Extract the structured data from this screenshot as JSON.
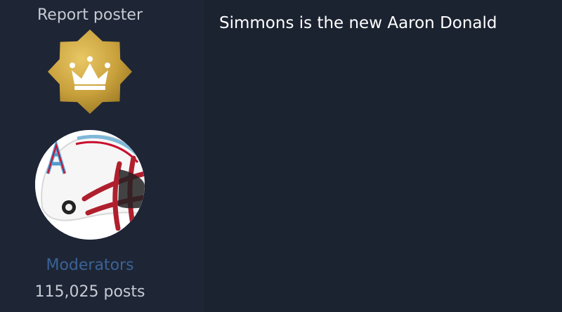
{
  "author": {
    "report_label": "Report poster",
    "rank_badge_icon": "crown-icon",
    "avatar_icon": "oilers-helmet-icon",
    "group_name": "Moderators",
    "post_count": "115,025 posts"
  },
  "post": {
    "text": "Simmons is the new Aaron Donald"
  },
  "colors": {
    "page_background": "#1b2230",
    "author_panel_background": "#1e2535",
    "badge_gold": "#c9a13c",
    "group_link": "#3a6396",
    "body_text": "#ffffff",
    "muted_text": "#c6cbd4"
  }
}
